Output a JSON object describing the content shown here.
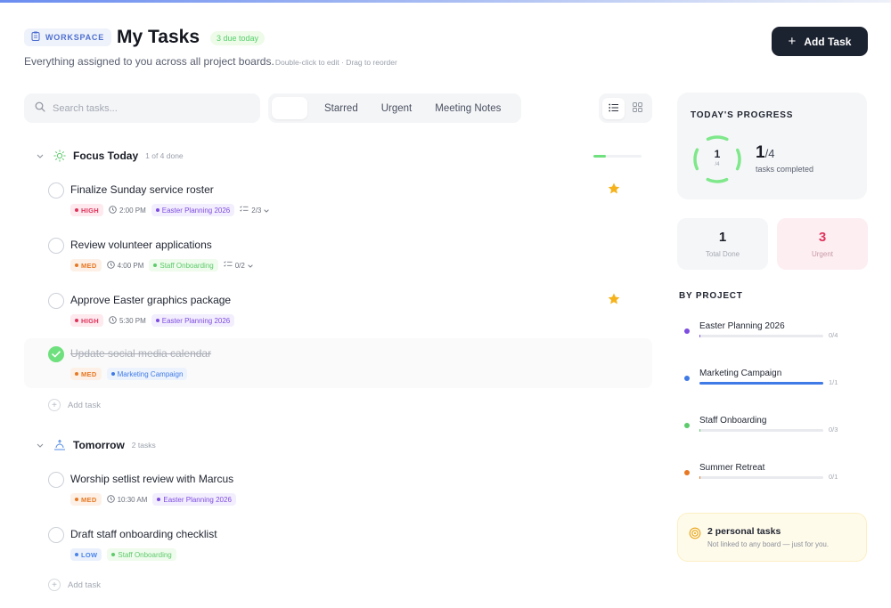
{
  "header": {
    "workspace_label": "WORKSPACE",
    "title": "My Tasks",
    "due_badge": "3 due today",
    "subtitle": "Everything assigned to you across all project boards.",
    "hint": "Double-click to edit · Drag to reorder",
    "add_task_label": "Add Task"
  },
  "toolbar": {
    "search_placeholder": "Search tasks...",
    "filters": [
      "",
      "Starred",
      "Urgent",
      "Meeting Notes"
    ],
    "view_modes": [
      "list",
      "grid"
    ]
  },
  "sections": [
    {
      "title": "Focus Today",
      "meta": "1 of 4 done",
      "progress": 0.25,
      "add_label": "Add task",
      "tasks": [
        {
          "title": "Finalize Sunday service roster",
          "priority": "HIGH",
          "time": "2:00 PM",
          "project": "Easter Planning 2026",
          "subtasks": "2/3",
          "starred": true,
          "done": false
        },
        {
          "title": "Review volunteer applications",
          "priority": "MED",
          "time": "4:00 PM",
          "project": "Staff Onboarding",
          "subtasks": "0/2",
          "starred": false,
          "done": false
        },
        {
          "title": "Approve Easter graphics package",
          "priority": "HIGH",
          "time": "5:30 PM",
          "project": "Easter Planning 2026",
          "starred": true,
          "done": false
        },
        {
          "title": "Update social media calendar",
          "priority": "MED",
          "project": "Marketing Campaign",
          "starred": false,
          "done": true
        }
      ]
    },
    {
      "title": "Tomorrow",
      "meta": "2 tasks",
      "add_label": "Add task",
      "tasks": [
        {
          "title": "Worship setlist review with Marcus",
          "priority": "MED",
          "time": "10:30 AM",
          "project": "Easter Planning 2026",
          "done": false
        },
        {
          "title": "Draft staff onboarding checklist",
          "priority": "LOW",
          "project": "Staff Onboarding",
          "done": false
        }
      ]
    }
  ],
  "sidebar": {
    "progress_label": "TODAY'S PROGRESS",
    "ring_value": "1",
    "ring_of": "/4",
    "done_count": "1",
    "total_count": "/4",
    "progress_caption": "tasks completed",
    "progress_fraction": 0.25,
    "stats": {
      "total_done": {
        "value": "1",
        "label": "Total Done"
      },
      "urgent": {
        "value": "3",
        "label": "Urgent"
      }
    },
    "by_project_label": "BY PROJECT",
    "projects": [
      {
        "name": "Easter Planning 2026",
        "count": "0/4",
        "fraction": 0.0,
        "color": "#7d4ce0"
      },
      {
        "name": "Marketing Campaign",
        "count": "1/1",
        "fraction": 1.0,
        "color": "#3f7ae6"
      },
      {
        "name": "Staff Onboarding",
        "count": "0/3",
        "fraction": 0.0,
        "color": "#5dcb6c"
      },
      {
        "name": "Summer Retreat",
        "count": "0/1",
        "fraction": 0.0,
        "color": "#e77823"
      }
    ],
    "personal": {
      "title": "2 personal tasks",
      "subtitle": "Not linked to any board — just for you."
    }
  },
  "colors": {
    "accent": "#1c2330",
    "high": "#e0335c",
    "med": "#e77823",
    "low": "#4b83ea",
    "done": "#6fe07e"
  }
}
